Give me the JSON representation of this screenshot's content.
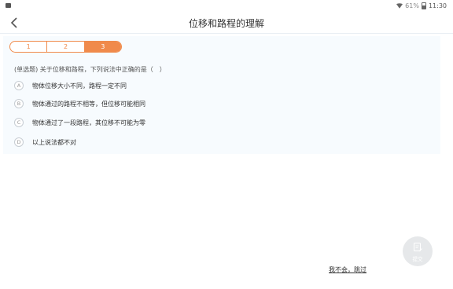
{
  "status_bar": {
    "battery_percent": "61%",
    "time": "11:30"
  },
  "header": {
    "title": "位移和路程的理解"
  },
  "tabs": [
    {
      "label": "1",
      "active": false
    },
    {
      "label": "2",
      "active": false
    },
    {
      "label": "3",
      "active": true
    }
  ],
  "question": {
    "text": "(单选题)  关于位移和路程，下列说法中正确的是（　）"
  },
  "options": [
    {
      "letter": "A",
      "text": "物体位移大小不同，路程一定不同"
    },
    {
      "letter": "B",
      "text": "物体通过的路程不相等，但位移可能相同"
    },
    {
      "letter": "C",
      "text": "物体通过了一段路程，其位移不可能为零"
    },
    {
      "letter": "D",
      "text": "以上说法都不对"
    }
  ],
  "actions": {
    "skip_label": "我不会，跳过",
    "submit_label": "提交"
  },
  "colors": {
    "accent": "#f08a4b",
    "panel_bg": "#f7fbfe"
  }
}
